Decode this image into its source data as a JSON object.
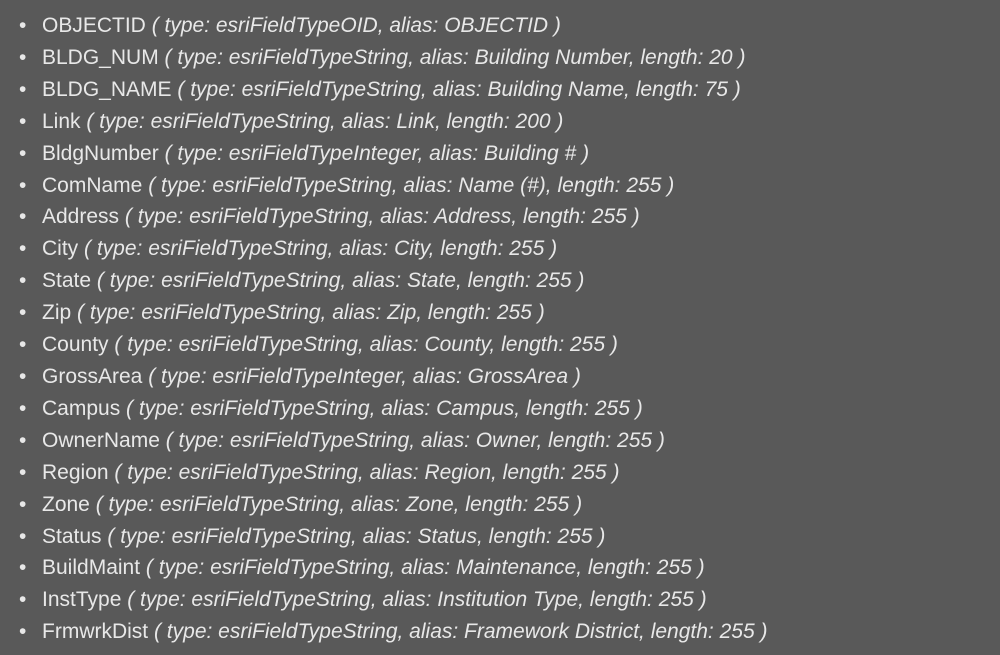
{
  "fields": [
    {
      "name": "OBJECTID",
      "details": "( type: esriFieldTypeOID, alias: OBJECTID )"
    },
    {
      "name": "BLDG_NUM",
      "details": "( type: esriFieldTypeString, alias: Building Number, length: 20 )"
    },
    {
      "name": "BLDG_NAME",
      "details": "( type: esriFieldTypeString, alias: Building Name, length: 75 )"
    },
    {
      "name": "Link",
      "details": "( type: esriFieldTypeString, alias: Link, length: 200 )"
    },
    {
      "name": "BldgNumber",
      "details": "( type: esriFieldTypeInteger, alias: Building # )"
    },
    {
      "name": "ComName",
      "details": "( type: esriFieldTypeString, alias: Name (#), length: 255 )"
    },
    {
      "name": "Address",
      "details": "( type: esriFieldTypeString, alias: Address, length: 255 )"
    },
    {
      "name": "City",
      "details": "( type: esriFieldTypeString, alias: City, length: 255 )"
    },
    {
      "name": "State",
      "details": "( type: esriFieldTypeString, alias: State, length: 255 )"
    },
    {
      "name": "Zip",
      "details": "( type: esriFieldTypeString, alias: Zip, length: 255 )"
    },
    {
      "name": "County",
      "details": "( type: esriFieldTypeString, alias: County, length: 255 )"
    },
    {
      "name": "GrossArea",
      "details": "( type: esriFieldTypeInteger, alias: GrossArea )"
    },
    {
      "name": "Campus",
      "details": "( type: esriFieldTypeString, alias: Campus, length: 255 )"
    },
    {
      "name": "OwnerName",
      "details": "( type: esriFieldTypeString, alias: Owner, length: 255 )"
    },
    {
      "name": "Region",
      "details": "( type: esriFieldTypeString, alias: Region, length: 255 )"
    },
    {
      "name": "Zone",
      "details": "( type: esriFieldTypeString, alias: Zone, length: 255 )"
    },
    {
      "name": "Status",
      "details": "( type: esriFieldTypeString, alias: Status, length: 255 )"
    },
    {
      "name": "BuildMaint",
      "details": "( type: esriFieldTypeString, alias: Maintenance, length: 255 )"
    },
    {
      "name": "InstType",
      "details": "( type: esriFieldTypeString, alias: Institution Type, length: 255 )"
    },
    {
      "name": "FrmwrkDist",
      "details": "( type: esriFieldTypeString, alias: Framework District, length: 255 )"
    }
  ]
}
